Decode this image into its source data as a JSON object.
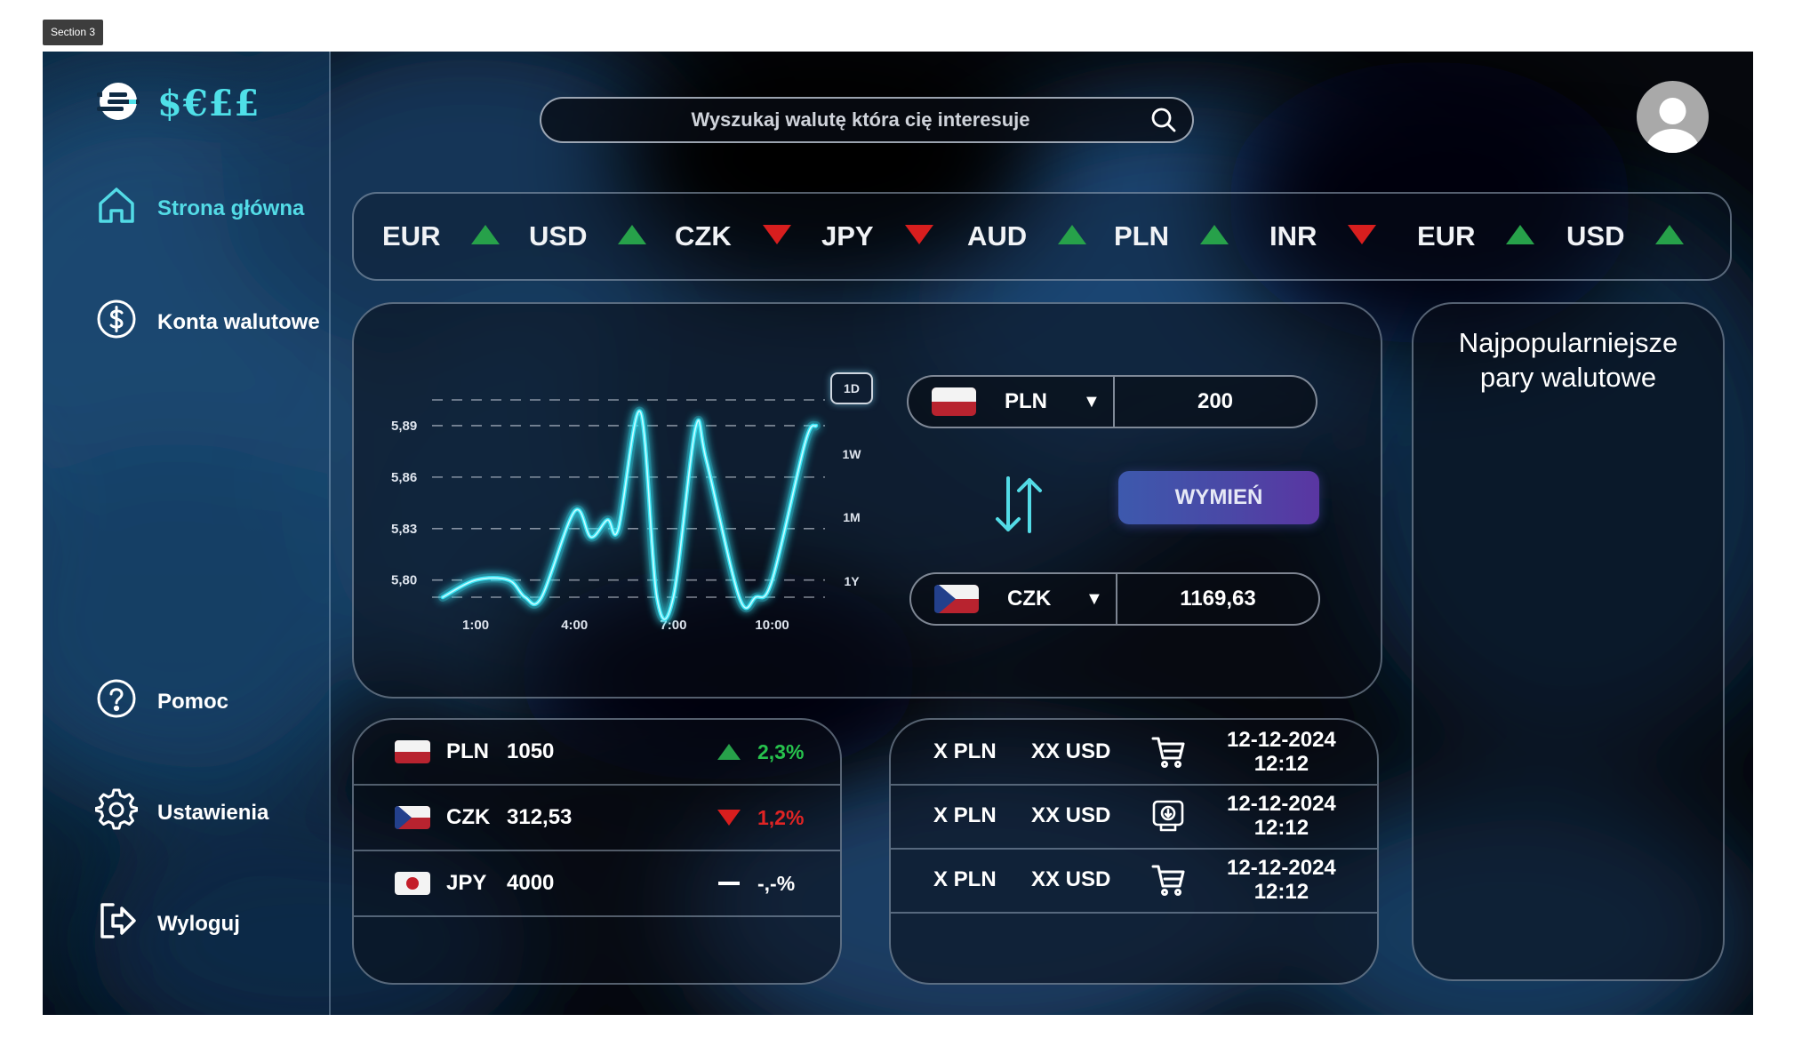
{
  "frame_label": "Section 3",
  "brand": {
    "logo_text": "$€££",
    "accent": "#53dbe6"
  },
  "nav": {
    "items": [
      {
        "label": "Strona główna",
        "icon": "home-icon",
        "active": true
      },
      {
        "label": "Konta walutowe",
        "icon": "dollar-circle-icon"
      },
      {
        "label": "Pomoc",
        "icon": "help-circle-icon"
      },
      {
        "label": "Ustawienia",
        "icon": "gear-icon"
      },
      {
        "label": "Wyloguj",
        "icon": "logout-icon"
      }
    ]
  },
  "search": {
    "placeholder": "Wyszukaj walutę która cię interesuje",
    "icon": "search-icon"
  },
  "user": {
    "icon": "avatar-icon"
  },
  "ticker": [
    {
      "code": "EUR",
      "trend": "up"
    },
    {
      "code": "USD",
      "trend": "up"
    },
    {
      "code": "CZK",
      "trend": "down"
    },
    {
      "code": "JPY",
      "trend": "down"
    },
    {
      "code": "AUD",
      "trend": "up"
    },
    {
      "code": "PLN",
      "trend": "up"
    },
    {
      "code": "INR",
      "trend": "down"
    },
    {
      "code": "EUR",
      "trend": "up"
    },
    {
      "code": "USD",
      "trend": "up"
    }
  ],
  "colors": {
    "up": "#27a14a",
    "down": "#d81e1e",
    "line": "#38e4f4"
  },
  "chart": {
    "y_ticks": [
      "5,89",
      "5,86",
      "5,83",
      "5,80"
    ],
    "x_ticks": [
      "1:00",
      "4:00",
      "7:00",
      "10:00"
    ],
    "ranges": [
      "1D",
      "1W",
      "1M",
      "1Y"
    ],
    "active_range": "1D"
  },
  "chart_data": {
    "type": "line",
    "x": [
      "0:00",
      "1:00",
      "2:00",
      "2:30",
      "3:00",
      "4:00",
      "4:30",
      "5:00",
      "5:20",
      "6:00",
      "6:30",
      "7:00",
      "7:40",
      "8:00",
      "9:00",
      "9:30",
      "10:00",
      "11:00",
      "11:20"
    ],
    "values": [
      5.79,
      5.8,
      5.8,
      5.79,
      5.79,
      5.84,
      5.825,
      5.835,
      5.83,
      5.898,
      5.79,
      5.79,
      5.888,
      5.87,
      5.79,
      5.79,
      5.8,
      5.88,
      5.89
    ],
    "ylim": [
      5.79,
      5.905
    ],
    "grid": true
  },
  "converter": {
    "from": {
      "code": "PLN",
      "amount": "200",
      "flag": "flag-pl"
    },
    "to": {
      "code": "CZK",
      "amount": "1169,63",
      "flag": "flag-cz"
    },
    "swap_icon": "swap-arrows-icon",
    "exchange_label": "WYMIEŃ"
  },
  "balances": [
    {
      "flag": "flag-pl",
      "code": "PLN",
      "amount": "1050",
      "trend": "up",
      "change": "2,3%"
    },
    {
      "flag": "flag-cz",
      "code": "CZK",
      "amount": "312,53",
      "trend": "down",
      "change": "1,2%"
    },
    {
      "flag": "flag-jp",
      "code": "JPY",
      "amount": "4000",
      "trend": "flat",
      "change": "-,-%"
    }
  ],
  "transactions": [
    {
      "from": "X PLN",
      "to": "XX USD",
      "icon": "cart-icon",
      "date": "12-12-2024",
      "time": "12:12"
    },
    {
      "from": "X PLN",
      "to": "XX USD",
      "icon": "atm-withdraw-icon",
      "date": "12-12-2024",
      "time": "12:12"
    },
    {
      "from": "X PLN",
      "to": "XX USD",
      "icon": "cart-icon",
      "date": "12-12-2024",
      "time": "12:12"
    }
  ],
  "popular": {
    "title": "Najpopularniejsze pary walutowe"
  }
}
